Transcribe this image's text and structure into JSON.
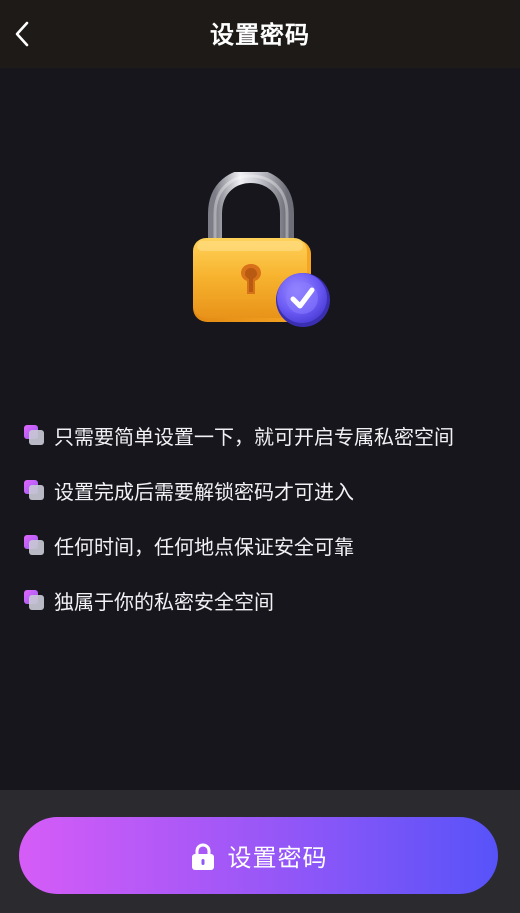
{
  "header": {
    "title": "设置密码",
    "back_icon": "chevron-left-icon"
  },
  "illustration": {
    "icon": "padlock-check-icon",
    "colors": {
      "lock_body": "#f7b731",
      "check_badge": "#6d5cf5"
    }
  },
  "features": [
    {
      "text": "只需要简单设置一下，就可开启专属私密空间",
      "icon": "bullet-square-icon"
    },
    {
      "text": "设置完成后需要解锁密码才可进入",
      "icon": "bullet-square-icon"
    },
    {
      "text": "任何时间，任何地点保证安全可靠",
      "icon": "bullet-square-icon"
    },
    {
      "text": "独属于你的私密安全空间",
      "icon": "bullet-square-icon"
    }
  ],
  "footer": {
    "button_label": "设置密码",
    "button_icon": "lock-icon",
    "gradient_start": "#d65cf7",
    "gradient_end": "#5753f9"
  }
}
